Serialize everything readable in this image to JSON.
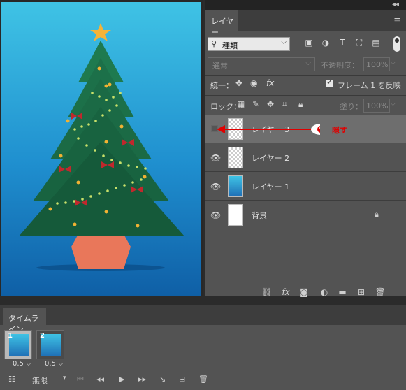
{
  "layers_panel": {
    "tab_label": "レイヤー",
    "filter": {
      "kind_label": "種類"
    },
    "blend_mode": "通常",
    "opacity_label": "不透明度：",
    "opacity_value": "100%",
    "unify_label": "統一：",
    "propagate_label": "フレーム 1 を反映",
    "lock_label": "ロック：",
    "fill_label": "塗り：",
    "fill_value": "100%",
    "layers": [
      {
        "name": "レイヤー 3",
        "visible": false,
        "selected": true,
        "thumb": "transparent"
      },
      {
        "name": "レイヤー 2",
        "visible": true,
        "selected": false,
        "thumb": "transparent"
      },
      {
        "name": "レイヤー 1",
        "visible": true,
        "selected": false,
        "thumb": "tree"
      },
      {
        "name": "背景",
        "visible": true,
        "selected": false,
        "thumb": "white",
        "locked": true
      }
    ],
    "annotation_label": "隠す",
    "annotation_color": "#e00000"
  },
  "timeline": {
    "tab_label": "タイムライン",
    "frames": [
      {
        "number": "1",
        "delay": "0.5",
        "selected": true
      },
      {
        "number": "2",
        "delay": "0.5",
        "selected": false
      }
    ],
    "loop_label": "無限"
  }
}
